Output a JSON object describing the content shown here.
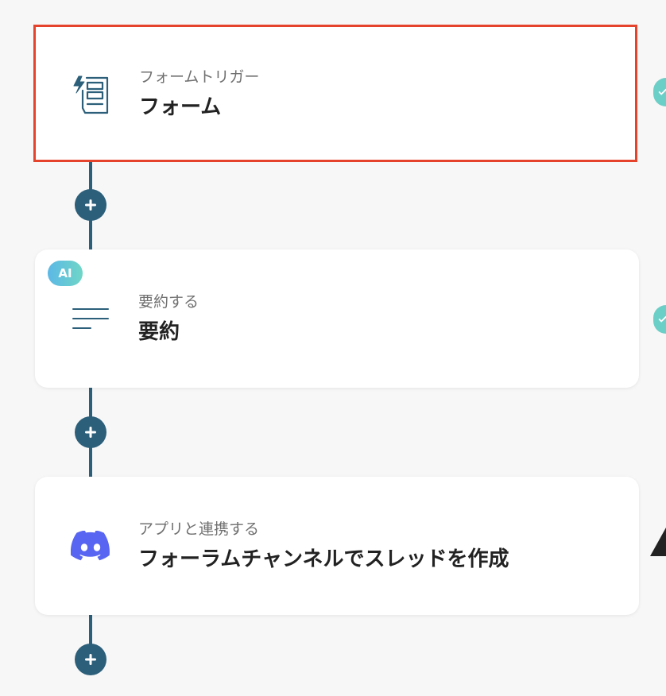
{
  "steps": [
    {
      "subtitle": "フォームトリガー",
      "title": "フォーム",
      "icon": "form-trigger-icon",
      "selected": true
    },
    {
      "subtitle": "要約する",
      "title": "要約",
      "icon": "summary-lines-icon",
      "badge": "AI"
    },
    {
      "subtitle": "アプリと連携する",
      "title": "フォーラムチャンネルでスレッドを作成",
      "icon": "discord-icon"
    }
  ],
  "colors": {
    "connector": "#2c5f7a",
    "selected_border": "#e5432b",
    "discord": "#5865f2",
    "status_check": "#6ccfc7",
    "ai_badge_start": "#5cb8e6",
    "ai_badge_end": "#6fd6c6"
  },
  "add_button_icon": "plus-icon",
  "status_icons": [
    "check-icon",
    "check-icon",
    "warning-icon"
  ]
}
